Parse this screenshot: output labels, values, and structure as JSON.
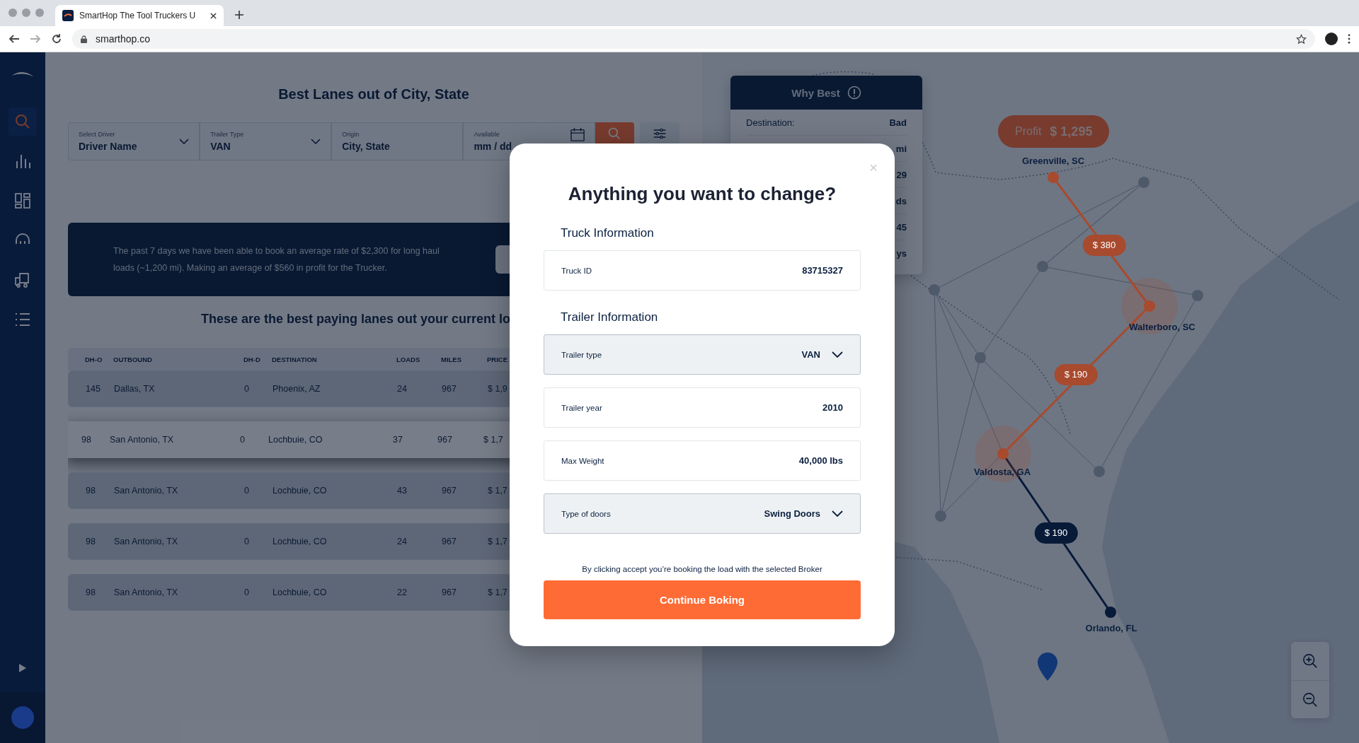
{
  "browser": {
    "tab_title": "SmartHop The Tool Truckers U",
    "url": "smarthop.co"
  },
  "sidebar": {
    "items": [
      {
        "kind": "search",
        "selected": true
      },
      {
        "kind": "chart",
        "selected": false
      },
      {
        "kind": "dashboard",
        "selected": false
      },
      {
        "kind": "support",
        "selected": false
      },
      {
        "kind": "truck",
        "selected": false
      },
      {
        "kind": "list",
        "selected": false
      }
    ]
  },
  "page": {
    "title": "Best Lanes out of City, State",
    "filters": [
      {
        "label": "Select Driver",
        "value": "Driver Name",
        "kind": "dropdown"
      },
      {
        "label": "Trailer Type",
        "value": "VAN",
        "kind": "dropdown"
      },
      {
        "label": "Origin",
        "value": "City, State",
        "kind": "text"
      },
      {
        "label": "Available",
        "value": "mm / dd",
        "kind": "date"
      }
    ],
    "banner": "The past 7 days we have been able to book an average rate of $2,300 for long haul loads (~1,200 mi). Making an average of $560 in profit for the Trucker.",
    "lanes_heading": "These are the best paying lanes out your current lo",
    "table": {
      "columns": [
        "DH-O",
        "OUTBOUND",
        "DH-D",
        "DESTINATION",
        "LOADS",
        "MILES",
        "PRICE"
      ],
      "rows": [
        {
          "cells": [
            "145",
            "Dallas, TX",
            "0",
            "Phoenix, AZ",
            "24",
            "967",
            "$ 1,9"
          ],
          "selected": false
        },
        {
          "cells": [
            "98",
            "San Antonio, TX",
            "0",
            "Lochbuie, CO",
            "37",
            "967",
            "$ 1,7"
          ],
          "selected": true
        },
        {
          "cells": [
            "98",
            "San Antonio, TX",
            "0",
            "Lochbuie, CO",
            "43",
            "967",
            "$ 1,7"
          ],
          "selected": false
        },
        {
          "cells": [
            "98",
            "San Antonio, TX",
            "0",
            "Lochbuie, CO",
            "24",
            "967",
            "$ 1,7"
          ],
          "selected": false
        },
        {
          "cells": [
            "98",
            "San Antonio, TX",
            "0",
            "Lochbuie, CO",
            "22",
            "967",
            "$ 1,7"
          ],
          "selected": false
        }
      ]
    }
  },
  "map": {
    "why_best": {
      "title": "Why Best",
      "rows": [
        {
          "label": "Destination:",
          "value": "Bad"
        },
        {
          "value": "mi"
        },
        {
          "value": "29"
        },
        {
          "value": "ds"
        },
        {
          "value": "45"
        },
        {
          "value": "ys"
        }
      ]
    },
    "profit": {
      "label": "Profit",
      "value": "$ 1,295"
    },
    "cities": [
      {
        "name": "Greenville, SC",
        "color": "#a84a2e",
        "highlighted": false
      },
      {
        "name": "Walterboro, SC",
        "color": "#a84a2e",
        "highlighted": true
      },
      {
        "name": "Valdosta, GA",
        "color": "#a84a2e",
        "highlighted": true
      },
      {
        "name": "Orlando, FL",
        "color": "#071a38",
        "highlighted": false
      }
    ],
    "legs": [
      {
        "price": "$ 380",
        "color": "#a84a2e"
      },
      {
        "price": "$ 190",
        "color": "#a84a2e"
      },
      {
        "price": "$ 190",
        "color": "#071a38"
      }
    ]
  },
  "modal": {
    "title": "Anything you want to change?",
    "close": "×",
    "sections": [
      {
        "heading": "Truck Information",
        "fields": [
          {
            "label": "Truck ID",
            "value": "83715327",
            "kind": "text"
          }
        ]
      },
      {
        "heading": "Trailer Information",
        "fields": [
          {
            "label": "Trailer type",
            "value": "VAN",
            "kind": "select"
          },
          {
            "label": "Trailer year",
            "value": "2010",
            "kind": "text"
          },
          {
            "label": "Max Weight",
            "value": "40,000 lbs",
            "kind": "text"
          },
          {
            "label": "Type of doors",
            "value": "Swing Doors",
            "kind": "select"
          }
        ]
      }
    ],
    "note": "By clicking accept you’re booking the load with the selected Broker",
    "button": "Continue Boking"
  }
}
